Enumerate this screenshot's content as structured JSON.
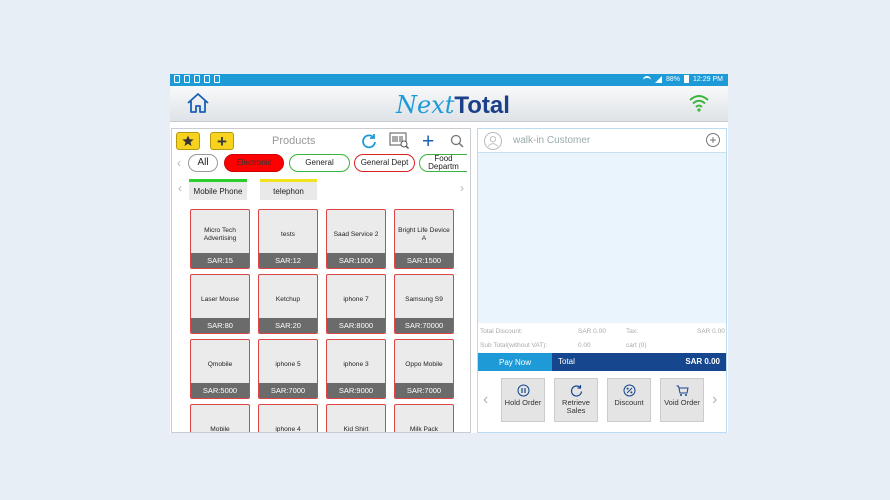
{
  "app": {
    "logo_next": "Next",
    "logo_total": "Total"
  },
  "statusbar": {
    "battery": "88%",
    "time": "12:29 PM"
  },
  "products": {
    "title": "Products",
    "categories": [
      "All",
      "Electronic",
      "General",
      "General Dept",
      "Food Departm"
    ],
    "subcategories": [
      "Mobile Phone",
      "telephon"
    ],
    "items": [
      {
        "name": "Micro Tech Advertising",
        "price": "SAR:15"
      },
      {
        "name": "tests",
        "price": "SAR:12"
      },
      {
        "name": "Saad Service 2",
        "price": "SAR:1000"
      },
      {
        "name": "Bright Life Device A",
        "price": "SAR:1500"
      },
      {
        "name": "Laser Mouse",
        "price": "SAR:80"
      },
      {
        "name": "Ketchup",
        "price": "SAR:20"
      },
      {
        "name": "iphone 7",
        "price": "SAR:8000"
      },
      {
        "name": "Samsung S9",
        "price": "SAR:70000"
      },
      {
        "name": "Qmobile",
        "price": "SAR:5000"
      },
      {
        "name": "iphone 5",
        "price": "SAR:7000"
      },
      {
        "name": "iphone 3",
        "price": "SAR:9000"
      },
      {
        "name": "Oppo Mobile",
        "price": "SAR:7000"
      },
      {
        "name": "Mobile",
        "price": ""
      },
      {
        "name": "iphone 4",
        "price": ""
      },
      {
        "name": "Kid Shirt",
        "price": ""
      },
      {
        "name": "Milk Pack",
        "price": ""
      }
    ]
  },
  "customer": {
    "name": "walk-in Customer"
  },
  "summary": {
    "total_discount_label": "Total Discount:",
    "total_discount_value": "SAR 0.00",
    "tax_label": "Tax:",
    "tax_value": "SAR 0.00",
    "subtotal_label": "Sub Total(without VAT):",
    "subtotal_value": "0.00",
    "cart_label": "cart (0)"
  },
  "pay": {
    "pay_now": "Pay Now",
    "total_label": "Total",
    "total_value": "SAR 0.00"
  },
  "actions": [
    "Hold Order",
    "Retrieve Sales",
    "Discount",
    "Void Order"
  ],
  "colors": {
    "brand_blue": "#1e9ad6",
    "navy": "#16468e",
    "accent_yellow": "#f7d21f"
  }
}
